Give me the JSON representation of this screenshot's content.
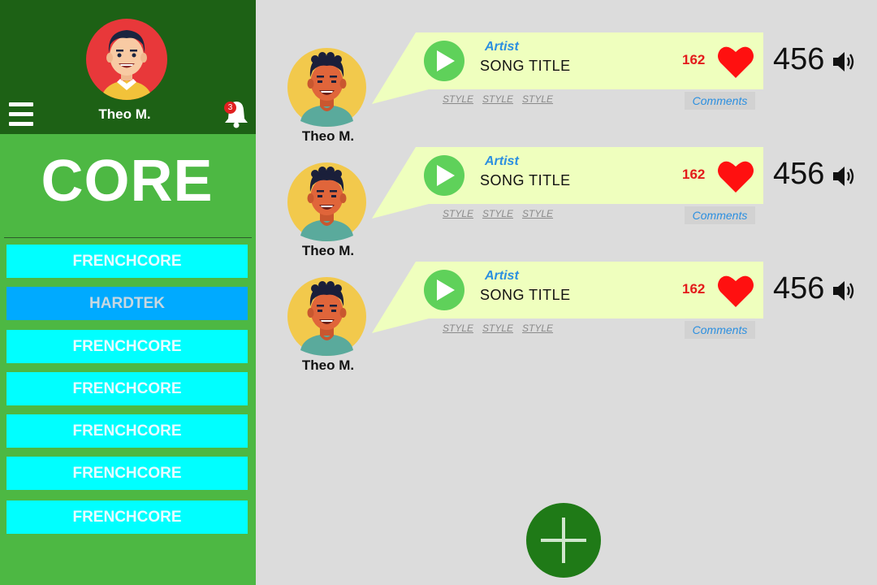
{
  "profile": {
    "name": "Theo M.",
    "notifications": "3"
  },
  "genre": {
    "title": "CORE"
  },
  "genres": [
    {
      "label": "FRENCHCORE",
      "active": false
    },
    {
      "label": "HARDTEK",
      "active": true
    },
    {
      "label": "FRENCHCORE",
      "active": false
    },
    {
      "label": "FRENCHCORE",
      "active": false
    },
    {
      "label": "FRENCHCORE",
      "active": false
    },
    {
      "label": "FRENCHCORE",
      "active": false
    },
    {
      "label": "FRENCHCORE",
      "active": false
    }
  ],
  "tracks": [
    {
      "user": "Theo M.",
      "artist": "Artist",
      "title": "SONG TITLE",
      "likes": "162",
      "plays": "456",
      "styles": [
        "STYLE",
        "STYLE",
        "STYLE"
      ],
      "comments_label": "Comments"
    },
    {
      "user": "Theo M.",
      "artist": "Artist",
      "title": "SONG TITLE",
      "likes": "162",
      "plays": "456",
      "styles": [
        "STYLE",
        "STYLE",
        "STYLE"
      ],
      "comments_label": "Comments"
    },
    {
      "user": "Theo M.",
      "artist": "Artist",
      "title": "SONG TITLE",
      "likes": "162",
      "plays": "456",
      "styles": [
        "STYLE",
        "STYLE",
        "STYLE"
      ],
      "comments_label": "Comments"
    }
  ],
  "icons": {
    "menu": "hamburger-icon",
    "notifications": "bell-icon",
    "play": "play-icon",
    "like": "heart-icon",
    "volume": "speaker-icon",
    "add": "plus-icon"
  },
  "colors": {
    "header": "#1d6115",
    "sidebar": "#4db843",
    "genre_item": "#00ffff",
    "genre_active": "#00aaff",
    "bubble": "#efffbe",
    "play": "#5fd15a",
    "like": "#ff1010",
    "accent_blue": "#2b8fe0",
    "add_button": "#1f7a17"
  }
}
